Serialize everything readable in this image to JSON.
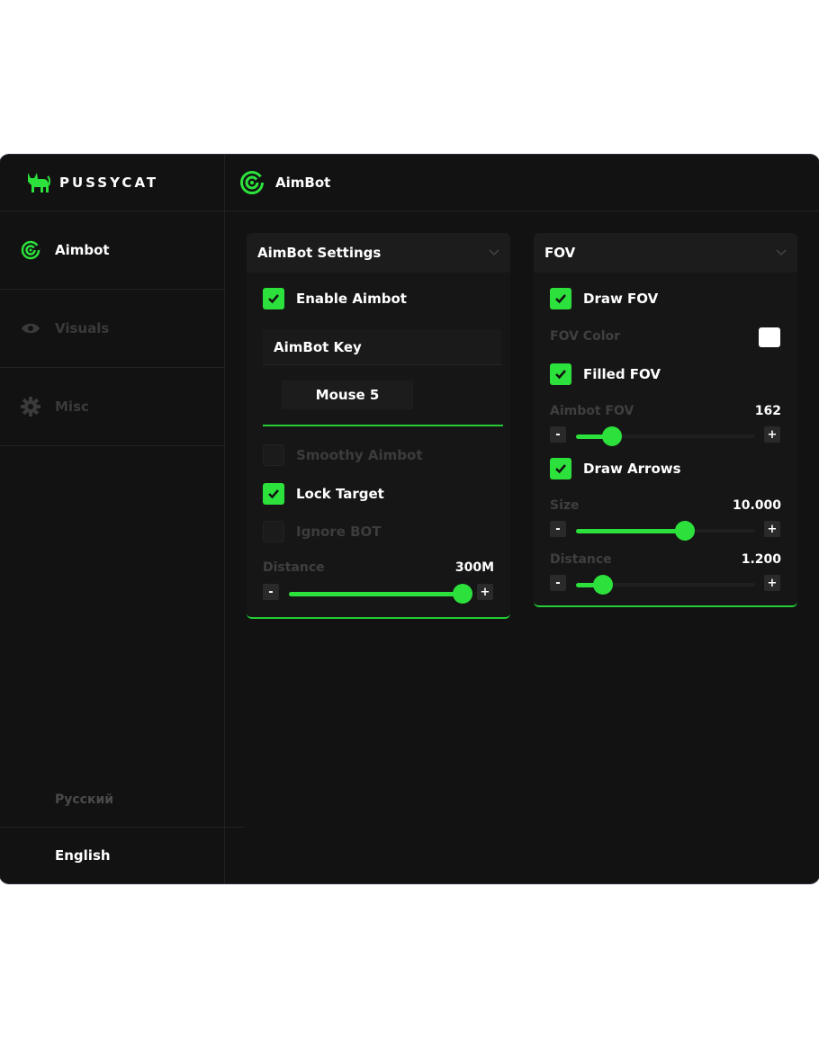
{
  "app": {
    "brand": "PUSSYCAT",
    "accent": "#2de13c"
  },
  "sidebar": {
    "items": [
      {
        "label": "Aimbot",
        "icon": "radar-icon",
        "active": true
      },
      {
        "label": "Visuals",
        "icon": "eye-icon",
        "active": false
      },
      {
        "label": "Misc",
        "icon": "gear-icon",
        "active": false
      }
    ],
    "languages": [
      "Русский",
      "English"
    ]
  },
  "header": {
    "title": "AimBot",
    "icon": "radar-icon"
  },
  "aimbot_panel": {
    "title": "AimBot Settings",
    "enable_aimbot": {
      "label": "Enable Aimbot",
      "checked": true
    },
    "aimbot_key_label": "AimBot Key",
    "aimbot_key_value": "Mouse 5",
    "smoothy_aimbot": {
      "label": "Smoothy Aimbot",
      "checked": false
    },
    "lock_target": {
      "label": "Lock Target",
      "checked": true
    },
    "ignore_bot": {
      "label": "Ignore BOT",
      "checked": false
    },
    "distance": {
      "label": "Distance",
      "value": "300M",
      "fraction": 0.97
    },
    "minus": "-",
    "plus": "+"
  },
  "fov_panel": {
    "title": "FOV",
    "draw_fov": {
      "label": "Draw FOV",
      "checked": true
    },
    "fov_color": {
      "label": "FOV Color",
      "color": "#ffffff"
    },
    "filled_fov": {
      "label": "Filled FOV",
      "checked": true
    },
    "aimbot_fov": {
      "label": "Aimbot FOV",
      "value": "162",
      "fraction": 0.2
    },
    "draw_arrows": {
      "label": "Draw Arrows",
      "checked": true
    },
    "size": {
      "label": "Size",
      "value": "10.000",
      "fraction": 0.61
    },
    "distance": {
      "label": "Distance",
      "value": "1.200",
      "fraction": 0.15
    },
    "minus": "-",
    "plus": "+"
  }
}
